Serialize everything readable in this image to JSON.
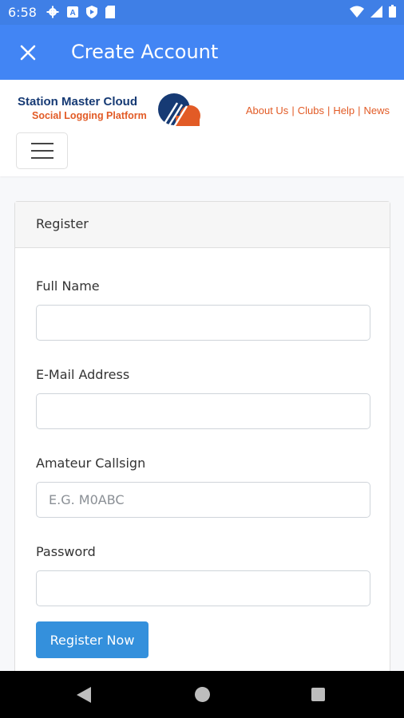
{
  "status_bar": {
    "time": "6:58",
    "left_icons": [
      "settings-gear-icon",
      "a-app-icon",
      "shield-play-icon",
      "sd-card-icon"
    ],
    "right_icons": [
      "wifi-icon",
      "signal-icon",
      "battery-icon"
    ]
  },
  "app_bar": {
    "title": "Create Account",
    "close_icon": "close-icon"
  },
  "site": {
    "logo_line1": "Station Master Cloud",
    "logo_line2": "Social Logging Platform",
    "links": [
      "About Us",
      "Clubs",
      "Help",
      "News"
    ],
    "menu_icon": "hamburger-menu-icon",
    "colors": {
      "brand_orange": "#e25b26",
      "brand_navy": "#163a74"
    }
  },
  "form": {
    "header": "Register",
    "fields": {
      "full_name": {
        "label": "Full Name",
        "value": "",
        "placeholder": ""
      },
      "email": {
        "label": "E-Mail Address",
        "value": "",
        "placeholder": ""
      },
      "callsign": {
        "label": "Amateur Callsign",
        "value": "",
        "placeholder": "E.G. M0ABC"
      },
      "password": {
        "label": "Password",
        "value": "",
        "placeholder": ""
      }
    },
    "submit_label": "Register Now",
    "accent": "#3490dc"
  },
  "nav_bar": {
    "icons": [
      "back-icon",
      "home-icon",
      "recents-icon"
    ]
  }
}
